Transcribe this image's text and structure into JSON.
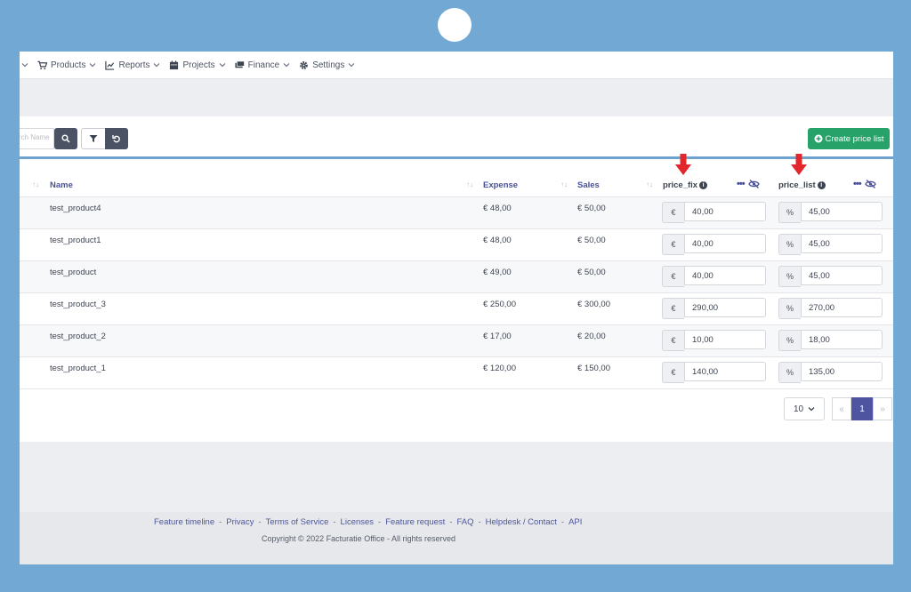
{
  "nav": {
    "items": [
      {
        "label": "Products",
        "icon": "cart-icon"
      },
      {
        "label": "Reports",
        "icon": "chart-icon"
      },
      {
        "label": "Projects",
        "icon": "calendar-icon"
      },
      {
        "label": "Finance",
        "icon": "money-icon"
      },
      {
        "label": "Settings",
        "icon": "gear-icon"
      }
    ]
  },
  "toolbar": {
    "search_placeholder": "search Name",
    "create_label": "Create price list",
    "create_color": "#27a36a"
  },
  "table": {
    "columns": {
      "name": "Name",
      "expense": "Expense",
      "sales": "Sales",
      "price_fix": "price_fix",
      "price_list": "price_list"
    },
    "rows": [
      {
        "name": "test_product4",
        "expense": "€ 48,00",
        "sales": "€ 50,00",
        "fix_addon": "€",
        "fix": "40,00",
        "list_addon": "%",
        "list": "45,00"
      },
      {
        "name": "test_product1",
        "expense": "€ 48,00",
        "sales": "€ 50,00",
        "fix_addon": "€",
        "fix": "40,00",
        "list_addon": "%",
        "list": "45,00"
      },
      {
        "name": "test_product",
        "expense": "€ 49,00",
        "sales": "€ 50,00",
        "fix_addon": "€",
        "fix": "40,00",
        "list_addon": "%",
        "list": "45,00"
      },
      {
        "name": "test_product_3",
        "expense": "€ 250,00",
        "sales": "€ 300,00",
        "fix_addon": "€",
        "fix": "290,00",
        "list_addon": "%",
        "list": "270,00"
      },
      {
        "name": "test_product_2",
        "expense": "€ 17,00",
        "sales": "€ 20,00",
        "fix_addon": "€",
        "fix": "10,00",
        "list_addon": "%",
        "list": "18,00"
      },
      {
        "name": "test_product_1",
        "expense": "€ 120,00",
        "sales": "€ 150,00",
        "fix_addon": "€",
        "fix": "140,00",
        "list_addon": "%",
        "list": "135,00"
      }
    ]
  },
  "pagination": {
    "page_size": "10",
    "prev": "«",
    "current": "1",
    "next": "»"
  },
  "footer": {
    "links": [
      "Feature timeline",
      "Privacy",
      "Terms of Service",
      "Licenses",
      "Feature request",
      "FAQ",
      "Helpdesk / Contact",
      "API"
    ],
    "copyright": "Copyright © 2022 Facturatie Office - All rights reserved"
  },
  "colors": {
    "frame": "#72a9d4",
    "accent": "#4e54a0",
    "annotation_arrow": "#e3262c"
  }
}
